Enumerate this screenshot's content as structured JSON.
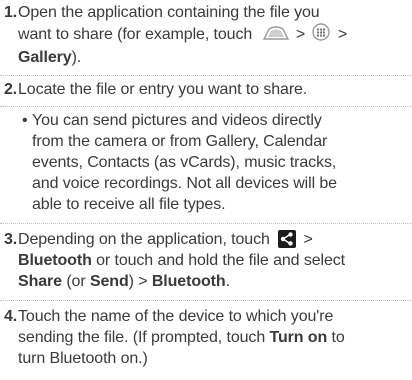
{
  "steps": [
    {
      "number": "1.",
      "line1": "Open the application containing the file you",
      "line2_pre": "want to share (for example, touch",
      "gt1": ">",
      "gt2": ">",
      "line3": "Gallery",
      "line3_end": ").",
      "icons": [
        "home-icon",
        "apps-grid-icon"
      ]
    },
    {
      "number": "2.",
      "line1": "Locate the file or entry you want to share.",
      "bullet": "•",
      "bullet_lines": [
        "You can send pictures and videos directly",
        "from the camera or from Gallery, Calendar",
        "events, Contacts (as vCards), music tracks,",
        "and voice recordings. Not all devices will be",
        "able to receive all file types."
      ]
    },
    {
      "number": "3.",
      "line1_pre": "Depending on the application, touch",
      "line1_gt": ">",
      "line2_b1": "Bluetooth",
      "line2_rest": " or touch and hold the file and select",
      "line3_b1": "Share",
      "line3_mid": " (or ",
      "line3_b2": "Send",
      "line3_mid2": ") ",
      "line3_gt": ">",
      "line3_b3": " Bluetooth",
      "line3_end": ".",
      "icons": [
        "share-icon"
      ]
    },
    {
      "number": "4.",
      "line1": "Touch the name of the device to which you're",
      "line2_pre": "sending the file. (If prompted, touch ",
      "line2_b": "Turn on",
      "line2_post": " to",
      "line3": "turn Bluetooth on.)"
    }
  ]
}
